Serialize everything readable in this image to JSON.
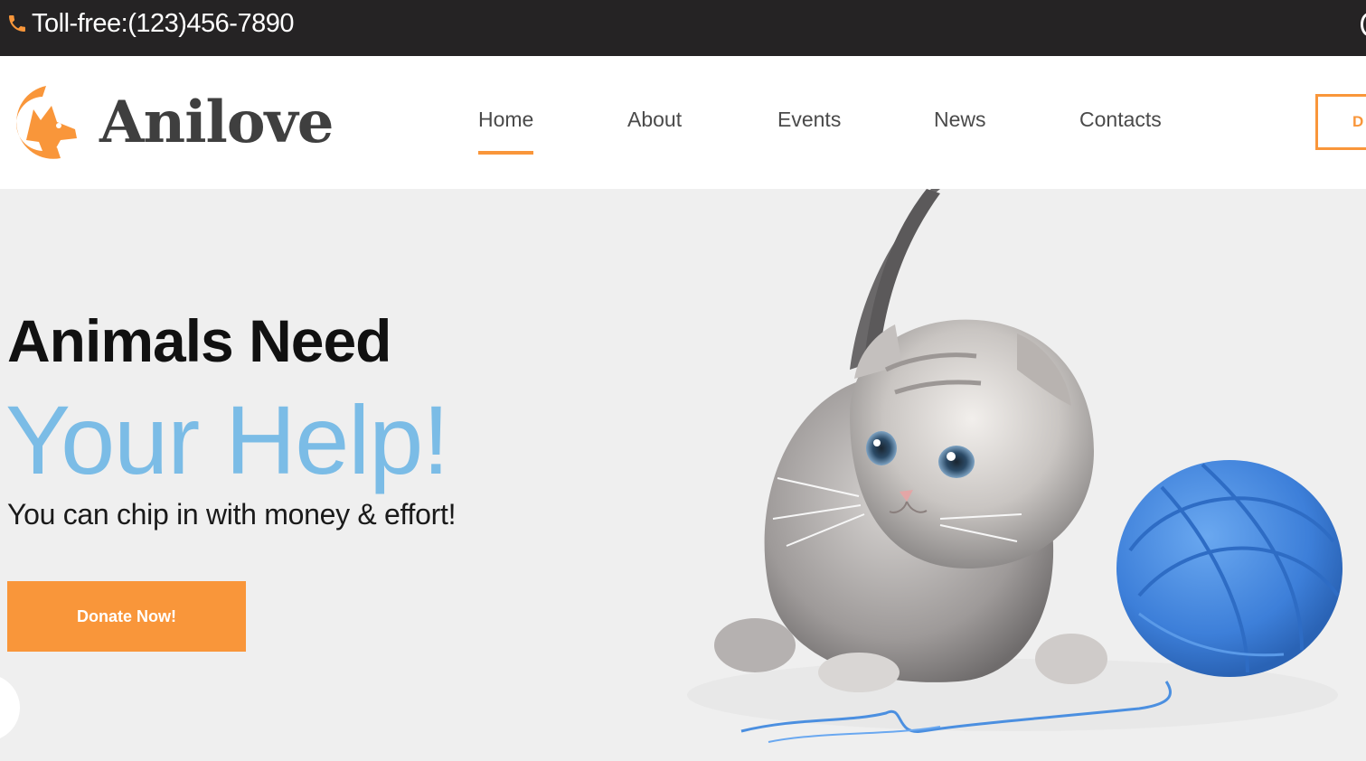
{
  "topbar": {
    "phone_icon": "phone-icon",
    "phone_text": "Toll-free:(123)456-7890"
  },
  "header": {
    "logo_text": "Anilove",
    "logo_icon": "cat-dog-logo-icon",
    "nav": [
      {
        "label": "Home",
        "active": true
      },
      {
        "label": "About"
      },
      {
        "label": "Events"
      },
      {
        "label": "News"
      },
      {
        "label": "Contacts"
      }
    ],
    "donate_outline_label": "D"
  },
  "hero": {
    "line1": "Animals Need",
    "line2": "Your Help!",
    "subtitle": "You can chip in with money & effort!",
    "button_label": "Donate Now!",
    "image": "kitten-with-yarn-ball"
  },
  "colors": {
    "accent": "#f9963a",
    "headline_blue": "#7bbce6",
    "topbar_bg": "#252324",
    "hero_bg": "#efefef"
  }
}
